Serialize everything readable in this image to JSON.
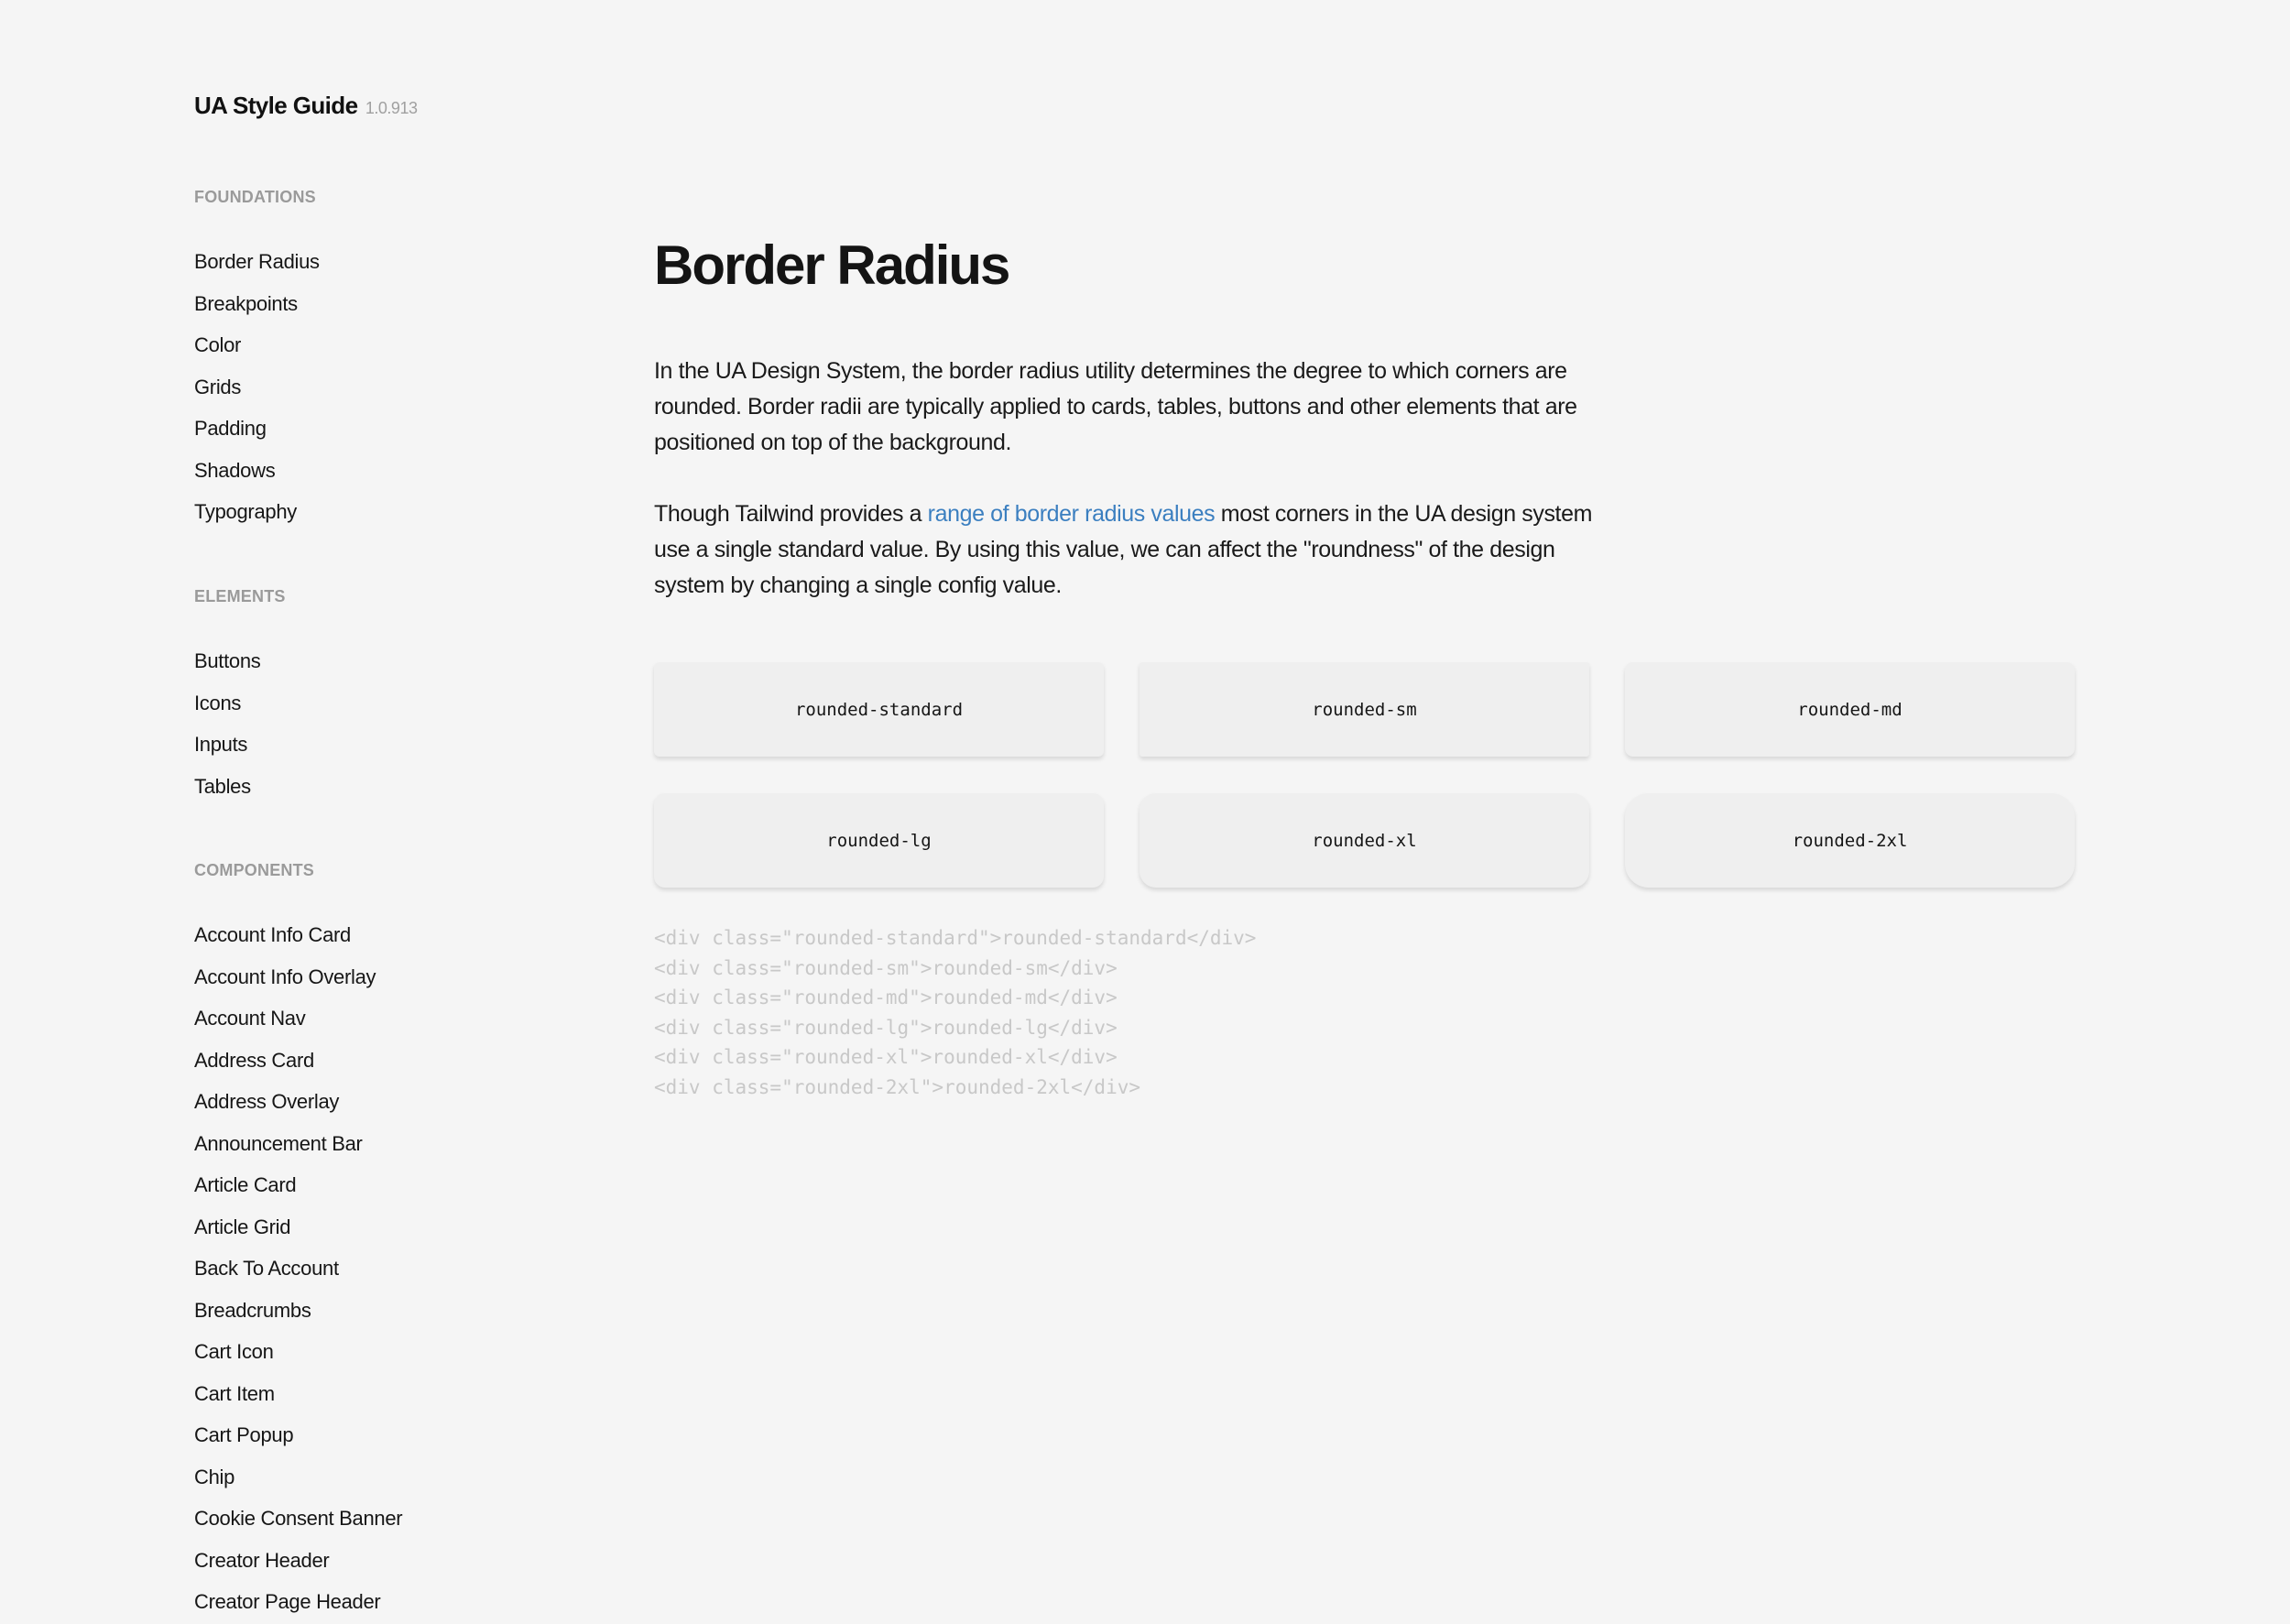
{
  "brand": {
    "name": "UA Style Guide",
    "version": "1.0.913"
  },
  "sidebar": {
    "sections": [
      {
        "heading": "Foundations",
        "items": [
          "Border Radius",
          "Breakpoints",
          "Color",
          "Grids",
          "Padding",
          "Shadows",
          "Typography"
        ]
      },
      {
        "heading": "Elements",
        "items": [
          "Buttons",
          "Icons",
          "Inputs",
          "Tables"
        ]
      },
      {
        "heading": "Components",
        "items": [
          "Account Info Card",
          "Account Info Overlay",
          "Account Nav",
          "Address Card",
          "Address Overlay",
          "Announcement Bar",
          "Article Card",
          "Article Grid",
          "Back To Account",
          "Breadcrumbs",
          "Cart Icon",
          "Cart Item",
          "Cart Popup",
          "Chip",
          "Cookie Consent Banner",
          "Creator Header",
          "Creator Page Header"
        ]
      }
    ]
  },
  "main": {
    "title": "Border Radius",
    "para1": "In the UA Design System, the border radius utility determines the degree to which corners are rounded. Border radii are typically applied to cards, tables, buttons and other elements that are positioned on top of the background.",
    "para2": {
      "before": "Though Tailwind provides a ",
      "link": "range of border radius values",
      "after": " most corners in the UA design system use a single standard value. By using this value, we can affect the \"roundness\" of the design system by changing a single config value."
    },
    "link_color": "#3b7fc0",
    "cards": [
      {
        "label": "rounded-standard",
        "radius": "standard"
      },
      {
        "label": "rounded-sm",
        "radius": "sm"
      },
      {
        "label": "rounded-md",
        "radius": "md"
      },
      {
        "label": "rounded-lg",
        "radius": "lg"
      },
      {
        "label": "rounded-xl",
        "radius": "xl"
      },
      {
        "label": "rounded-2xl",
        "radius": "2xl"
      }
    ],
    "code_lines": [
      "<div class=\"rounded-standard\">rounded-standard</div>",
      "<div class=\"rounded-sm\">rounded-sm</div>",
      "<div class=\"rounded-md\">rounded-md</div>",
      "<div class=\"rounded-lg\">rounded-lg</div>",
      "<div class=\"rounded-xl\">rounded-xl</div>",
      "<div class=\"rounded-2xl\">rounded-2xl</div>"
    ]
  }
}
